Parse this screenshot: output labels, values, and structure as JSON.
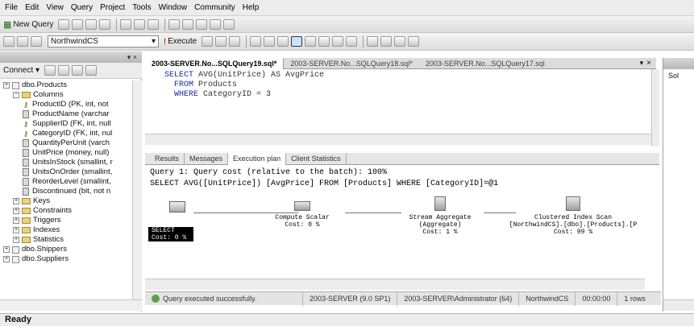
{
  "menubar": [
    "File",
    "Edit",
    "View",
    "Query",
    "Project",
    "Tools",
    "Window",
    "Community",
    "Help"
  ],
  "toolbar1": {
    "new_query": "New Query"
  },
  "toolbar2": {
    "database": "NorthwindCS",
    "execute": "Execute"
  },
  "object_explorer": {
    "connect": "Connect",
    "tree": [
      {
        "label": "dbo.Products",
        "kind": "table",
        "indent": 0
      },
      {
        "label": "Columns",
        "kind": "folder",
        "indent": 1,
        "expanded": true
      },
      {
        "label": "ProductID (PK, int, not",
        "kind": "key",
        "indent": 2
      },
      {
        "label": "ProductName (varchar",
        "kind": "col",
        "indent": 2
      },
      {
        "label": "SupplierID (FK, int, null",
        "kind": "key",
        "indent": 2
      },
      {
        "label": "CategoryID (FK, int, nul",
        "kind": "key",
        "indent": 2
      },
      {
        "label": "QuantityPerUnit (varch",
        "kind": "col",
        "indent": 2
      },
      {
        "label": "UnitPrice (money, null)",
        "kind": "col",
        "indent": 2
      },
      {
        "label": "UnitsInStock (smallint, r",
        "kind": "col",
        "indent": 2
      },
      {
        "label": "UnitsOnOrder (smallint,",
        "kind": "col",
        "indent": 2
      },
      {
        "label": "ReorderLevel (smallint,",
        "kind": "col",
        "indent": 2
      },
      {
        "label": "Discontinued (bit, not n",
        "kind": "col",
        "indent": 2
      },
      {
        "label": "Keys",
        "kind": "folder",
        "indent": 1
      },
      {
        "label": "Constraints",
        "kind": "folder",
        "indent": 1
      },
      {
        "label": "Triggers",
        "kind": "folder",
        "indent": 1
      },
      {
        "label": "Indexes",
        "kind": "folder",
        "indent": 1
      },
      {
        "label": "Statistics",
        "kind": "folder",
        "indent": 1
      },
      {
        "label": "dbo.Shippers",
        "kind": "table",
        "indent": 0
      },
      {
        "label": "dbo.Suppliers",
        "kind": "table",
        "indent": 0
      }
    ]
  },
  "tabs": {
    "active": "2003-SERVER.No...SQLQuery19.sql*",
    "tab2": "2003-SERVER.No...SQLQuery18.sql*",
    "tab3": "2003-SERVER.No...SQLQuery17.sql",
    "pin": "▾",
    "close": "×"
  },
  "editor": {
    "line1_kw": "SELECT",
    "line1_rest": " AVG(UnitPrice) AS AvgPrice",
    "line2_kw": "FROM",
    "line2_rest": " Products",
    "line3_kw": "WHERE",
    "line3_rest": " CategoryID = 3"
  },
  "results_tabs": [
    "Results",
    "Messages",
    "Execution plan",
    "Client Statistics"
  ],
  "plan": {
    "header1": "Query 1: Query cost (relative to the batch): 100%",
    "header2": "SELECT AVG([UnitPrice]) [AvgPrice] FROM [Products] WHERE [CategoryID]=@1",
    "select_label": "SELECT",
    "select_cost": "Cost: 0 %",
    "compute_label": "Compute Scalar",
    "compute_cost": "Cost: 0 %",
    "stream_label": "Stream Aggregate",
    "stream_sub": "(Aggregate)",
    "stream_cost": "Cost: 1 %",
    "index_label": "Clustered Index Scan",
    "index_sub": "[NorthwindCS].[dbo].[Products].[P",
    "index_cost": "Cost: 99 %"
  },
  "query_status": {
    "message": "Query executed successfully.",
    "server": "2003-SERVER (9.0 SP1)",
    "user": "2003-SERVER\\Administrator (64)",
    "database": "NorthwindCS",
    "time": "00:00:00",
    "rows": "1 rows"
  },
  "properties": {
    "item": "Sol"
  },
  "statusbar": {
    "text": "Ready"
  }
}
